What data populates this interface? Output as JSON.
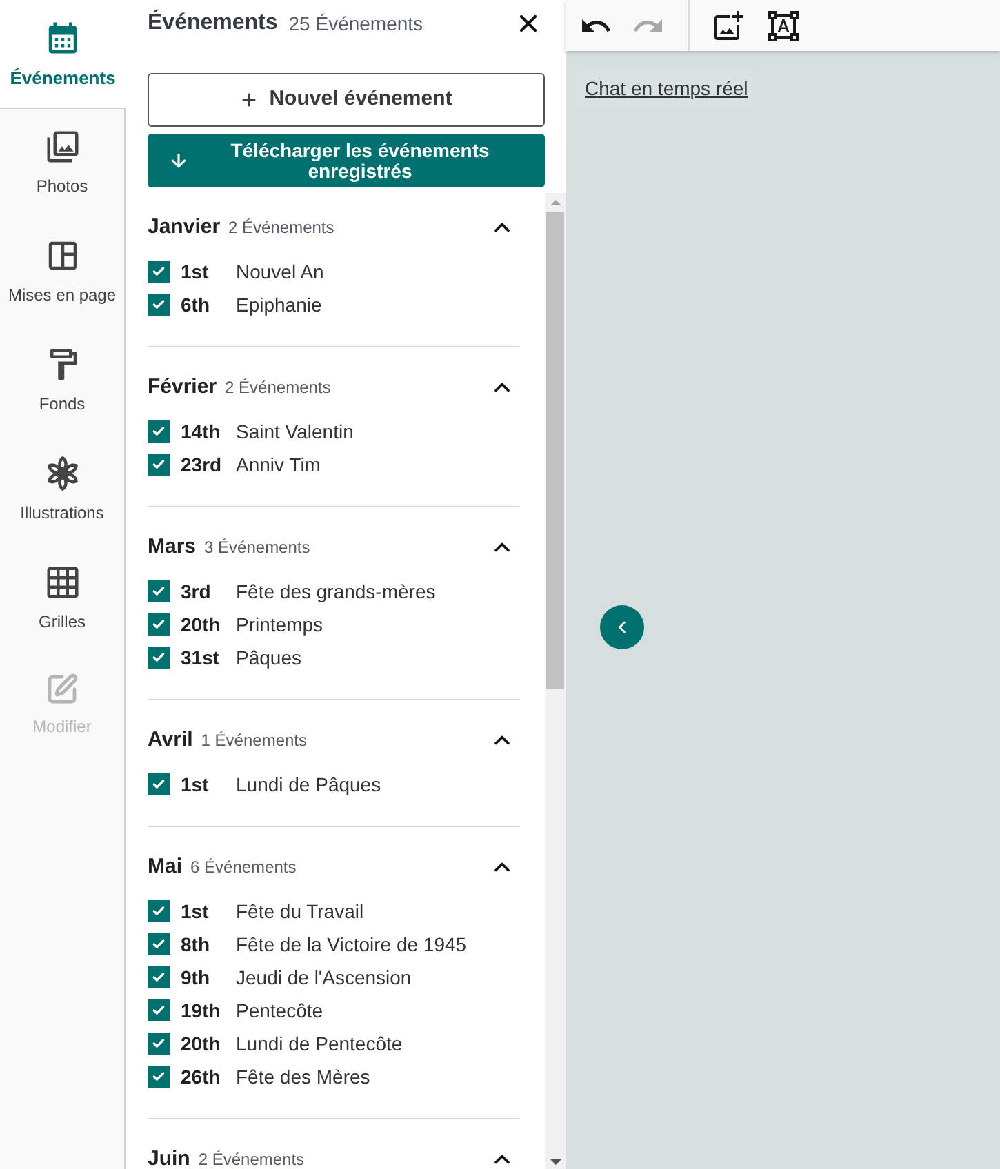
{
  "nav": {
    "items": [
      {
        "label": "Événements",
        "kind": "calendar",
        "selected": true,
        "disabled": false
      },
      {
        "label": "Photos",
        "kind": "photos",
        "selected": false,
        "disabled": false
      },
      {
        "label": "Mises en page",
        "kind": "layout",
        "selected": false,
        "disabled": false
      },
      {
        "label": "Fonds",
        "kind": "paint-roller",
        "selected": false,
        "disabled": false
      },
      {
        "label": "Illustrations",
        "kind": "flower",
        "selected": false,
        "disabled": false
      },
      {
        "label": "Grilles",
        "kind": "grid",
        "selected": false,
        "disabled": false
      },
      {
        "label": "Modifier",
        "kind": "edit",
        "selected": false,
        "disabled": true
      }
    ]
  },
  "panel": {
    "title": "Événements",
    "count": "25 Événements",
    "new_button": {
      "label": "Nouvel événement"
    },
    "download_button": {
      "label": "Télécharger les événements enregistrés"
    },
    "months": [
      {
        "name": "Janvier",
        "count": "2 Événements",
        "expanded": true,
        "events": [
          {
            "day": "1st",
            "title": "Nouvel An",
            "checked": true
          },
          {
            "day": "6th",
            "title": "Epiphanie",
            "checked": true
          }
        ]
      },
      {
        "name": "Février",
        "count": "2 Événements",
        "expanded": true,
        "events": [
          {
            "day": "14th",
            "title": "Saint Valentin",
            "checked": true
          },
          {
            "day": "23rd",
            "title": "Anniv Tim",
            "checked": true
          }
        ]
      },
      {
        "name": "Mars",
        "count": "3 Événements",
        "expanded": true,
        "events": [
          {
            "day": "3rd",
            "title": "Fête des grands-mères",
            "checked": true
          },
          {
            "day": "20th",
            "title": "Printemps",
            "checked": true
          },
          {
            "day": "31st",
            "title": "Pâques",
            "checked": true
          }
        ]
      },
      {
        "name": "Avril",
        "count": "1 Événements",
        "expanded": true,
        "events": [
          {
            "day": "1st",
            "title": "Lundi de Pâques",
            "checked": true
          }
        ]
      },
      {
        "name": "Mai",
        "count": "6 Événements",
        "expanded": true,
        "events": [
          {
            "day": "1st",
            "title": "Fête du Travail",
            "checked": true
          },
          {
            "day": "8th",
            "title": "Fête de la Victoire de 1945",
            "checked": true
          },
          {
            "day": "9th",
            "title": "Jeudi de l'Ascension",
            "checked": true
          },
          {
            "day": "19th",
            "title": "Pentecôte",
            "checked": true
          },
          {
            "day": "20th",
            "title": "Lundi de Pentecôte",
            "checked": true
          },
          {
            "day": "26th",
            "title": "Fête des Mères",
            "checked": true
          }
        ]
      },
      {
        "name": "Juin",
        "count": "2 Événements",
        "expanded": true
      }
    ]
  },
  "toolbar": {
    "history": [
      {
        "kind": "undo",
        "disabled": false
      },
      {
        "kind": "redo",
        "disabled": true
      }
    ],
    "insert": [
      {
        "kind": "add-image",
        "disabled": false
      },
      {
        "kind": "text-box",
        "disabled": false
      }
    ]
  },
  "canvas": {
    "link": "Chat en temps réel"
  }
}
